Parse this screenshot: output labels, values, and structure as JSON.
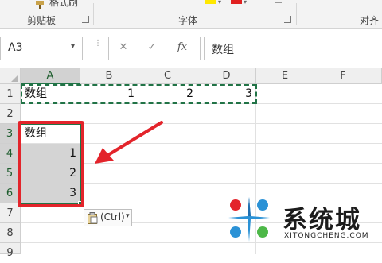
{
  "ribbon": {
    "top_cut_label": "格式刷",
    "groups": [
      {
        "label": "剪贴板"
      },
      {
        "label": "字体"
      },
      {
        "label": "对齐"
      }
    ],
    "swatch_colors": {
      "highlight": "#ffe800",
      "font": "#e02020"
    }
  },
  "formula_bar": {
    "name_box": "A3",
    "cancel_icon": "✕",
    "enter_icon": "✓",
    "fx_label": "fx",
    "content": "数组"
  },
  "sheet": {
    "columns": [
      "A",
      "B",
      "C",
      "D",
      "E",
      "F"
    ],
    "rows": [
      "1",
      "2",
      "3",
      "4",
      "5",
      "6",
      "7",
      "8",
      "9"
    ],
    "row1": {
      "a": "数组",
      "b": "1",
      "c": "2",
      "d": "3"
    },
    "pasted": {
      "a3": "数组",
      "a4": "1",
      "a5": "2",
      "a6": "3"
    },
    "paste_options": {
      "label": "(Ctrl)",
      "arrow": "▾"
    }
  },
  "annotation": {
    "highlight_color": "#e3242b",
    "marching_ants_color": "#217346"
  },
  "watermark": {
    "brand": "系统城",
    "url": "XITONGCHENG.COM"
  }
}
